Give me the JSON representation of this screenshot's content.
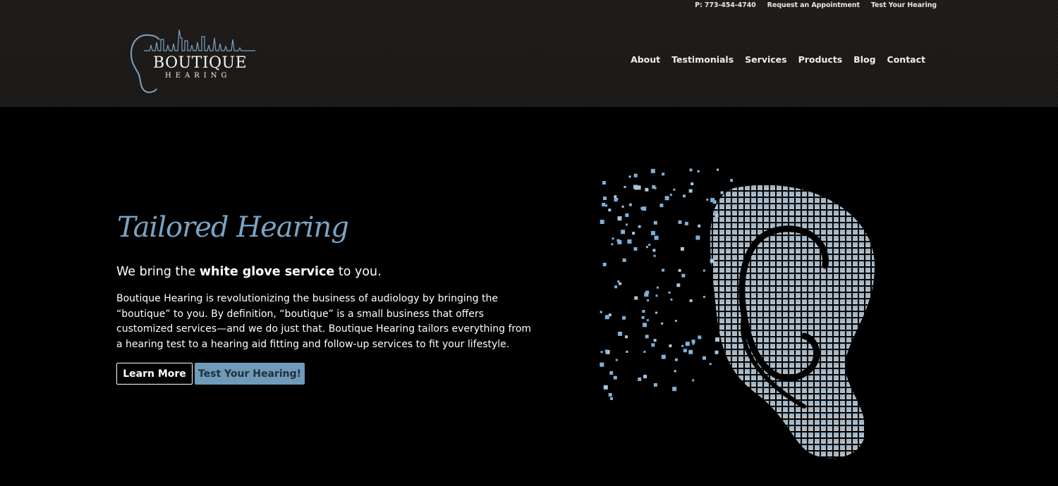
{
  "header": {
    "top_bar": {
      "phone": "P: 773-454-4740",
      "appointment": "Request an Appointment",
      "test": "Test Your Hearing"
    },
    "logo": {
      "word": "BOUTIQUE",
      "sub": "HEARING"
    },
    "nav": [
      "About",
      "Testimonials",
      "Services",
      "Products",
      "Blog",
      "Contact"
    ]
  },
  "hero": {
    "script_title": "Tailored Hearing",
    "tagline_pre": "We bring the ",
    "tagline_bold": "white glove service",
    "tagline_post": " to you.",
    "body": "Boutique Hearing is revolutionizing the business of audiology by bringing the “boutique” to you. By definition, “boutique” is a small business that offers customized services—and we do just that. Boutique Hearing tailors everything from a hearing test to a hearing aid fitting and follow-up services to fit your lifestyle.",
    "learn_more": "Learn More",
    "test_button": "Test Your Hearing!"
  },
  "colors": {
    "accent": "#7aa3c3",
    "button_fill": "#6f9ab8",
    "header_bg": "#1d1a18",
    "page_bg": "#000000"
  },
  "icons": {
    "logo_mark": "ear-skyline-logo-icon",
    "hero_art": "pixelated-ear-icon"
  }
}
